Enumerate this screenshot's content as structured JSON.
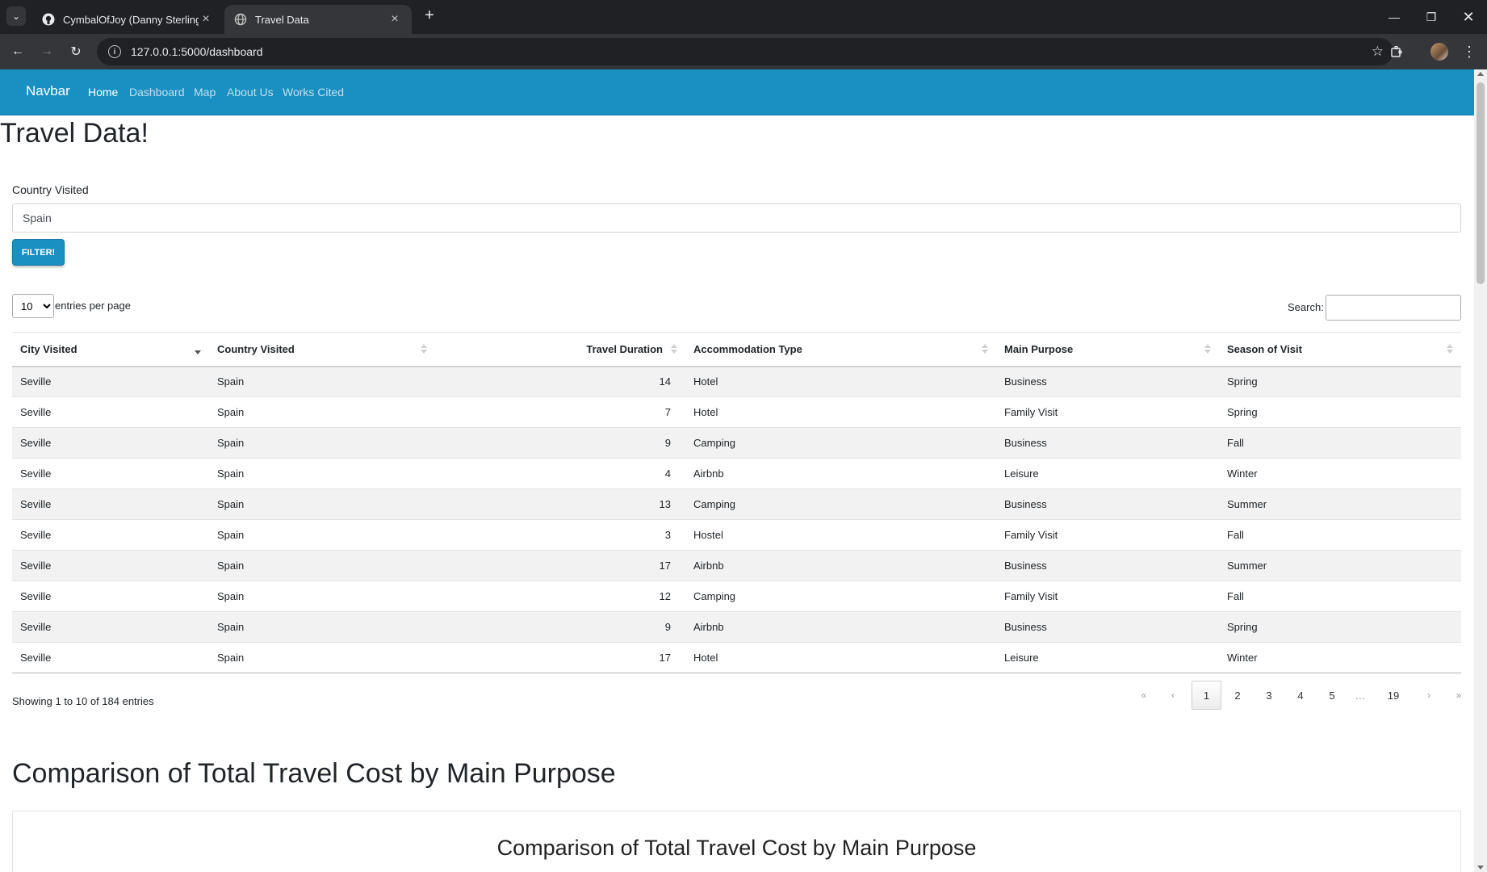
{
  "browser": {
    "tabs": [
      {
        "title": "CymbalOfJoy (Danny Sterling)",
        "active": false
      },
      {
        "title": "Travel Data",
        "active": true
      }
    ],
    "url": "127.0.0.1:5000/dashboard"
  },
  "navbar": {
    "brand": "Navbar",
    "links": [
      "Home",
      "Dashboard",
      "Map",
      "About Us",
      "Works Cited"
    ],
    "active_link": "Home",
    "color": "#1a8fc1"
  },
  "page": {
    "title": "Travel Data!",
    "filter": {
      "label": "Country Visited",
      "value": "Spain",
      "button": "Filter!"
    }
  },
  "table": {
    "length_value": "10",
    "length_label": "entries per page",
    "search_label": "Search:",
    "columns": [
      "City Visited",
      "Country Visited",
      "Travel Duration",
      "Accommodation Type",
      "Main Purpose",
      "Season of Visit"
    ],
    "rows": [
      [
        "Seville",
        "Spain",
        "14",
        "Hotel",
        "Business",
        "Spring"
      ],
      [
        "Seville",
        "Spain",
        "7",
        "Hotel",
        "Family Visit",
        "Spring"
      ],
      [
        "Seville",
        "Spain",
        "9",
        "Camping",
        "Business",
        "Fall"
      ],
      [
        "Seville",
        "Spain",
        "4",
        "Airbnb",
        "Leisure",
        "Winter"
      ],
      [
        "Seville",
        "Spain",
        "13",
        "Camping",
        "Business",
        "Summer"
      ],
      [
        "Seville",
        "Spain",
        "3",
        "Hostel",
        "Family Visit",
        "Fall"
      ],
      [
        "Seville",
        "Spain",
        "17",
        "Airbnb",
        "Business",
        "Summer"
      ],
      [
        "Seville",
        "Spain",
        "12",
        "Camping",
        "Family Visit",
        "Fall"
      ],
      [
        "Seville",
        "Spain",
        "9",
        "Airbnb",
        "Business",
        "Spring"
      ],
      [
        "Seville",
        "Spain",
        "17",
        "Hotel",
        "Leisure",
        "Winter"
      ]
    ],
    "info": "Showing 1 to 10 of 184 entries",
    "pagination": [
      "«",
      "‹",
      "1",
      "2",
      "3",
      "4",
      "5",
      "…",
      "19",
      "›",
      "»"
    ],
    "current_page": "1"
  },
  "chart_section": {
    "heading": "Comparison of Total Travel Cost by Main Purpose",
    "chart_title": "Comparison of Total Travel Cost by Main Purpose"
  }
}
